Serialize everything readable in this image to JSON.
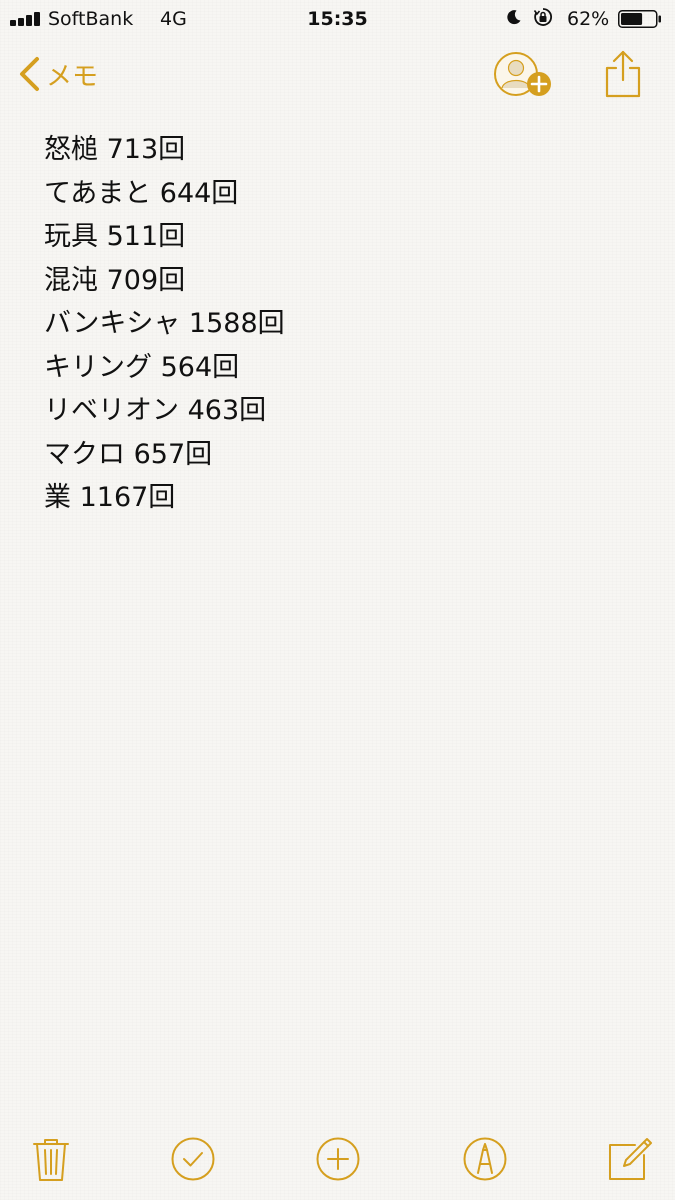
{
  "status_bar": {
    "carrier": "SoftBank",
    "network": "4G",
    "time": "15:35",
    "battery_percent": "62%",
    "battery_level": 0.62,
    "icons": [
      "signal-bars-icon",
      "moon-icon",
      "orientation-lock-icon",
      "battery-icon"
    ]
  },
  "nav": {
    "back_label": "メモ",
    "icons": [
      "chevron-left-icon",
      "add-person-icon",
      "share-icon"
    ]
  },
  "note": {
    "lines": [
      "怒槌 713回",
      "てあまと 644回",
      "玩具 511回",
      "混沌 709回",
      "バンキシャ 1588回",
      "キリング 564回",
      "リベリオン 463回",
      "マクロ 657回",
      "業 1167回"
    ]
  },
  "toolbar": {
    "icons": [
      "trash-icon",
      "checklist-icon",
      "add-icon",
      "markup-icon",
      "compose-icon"
    ]
  },
  "colors": {
    "accent": "#d59f1f",
    "text": "#111111",
    "background": "#f7f6f3"
  }
}
